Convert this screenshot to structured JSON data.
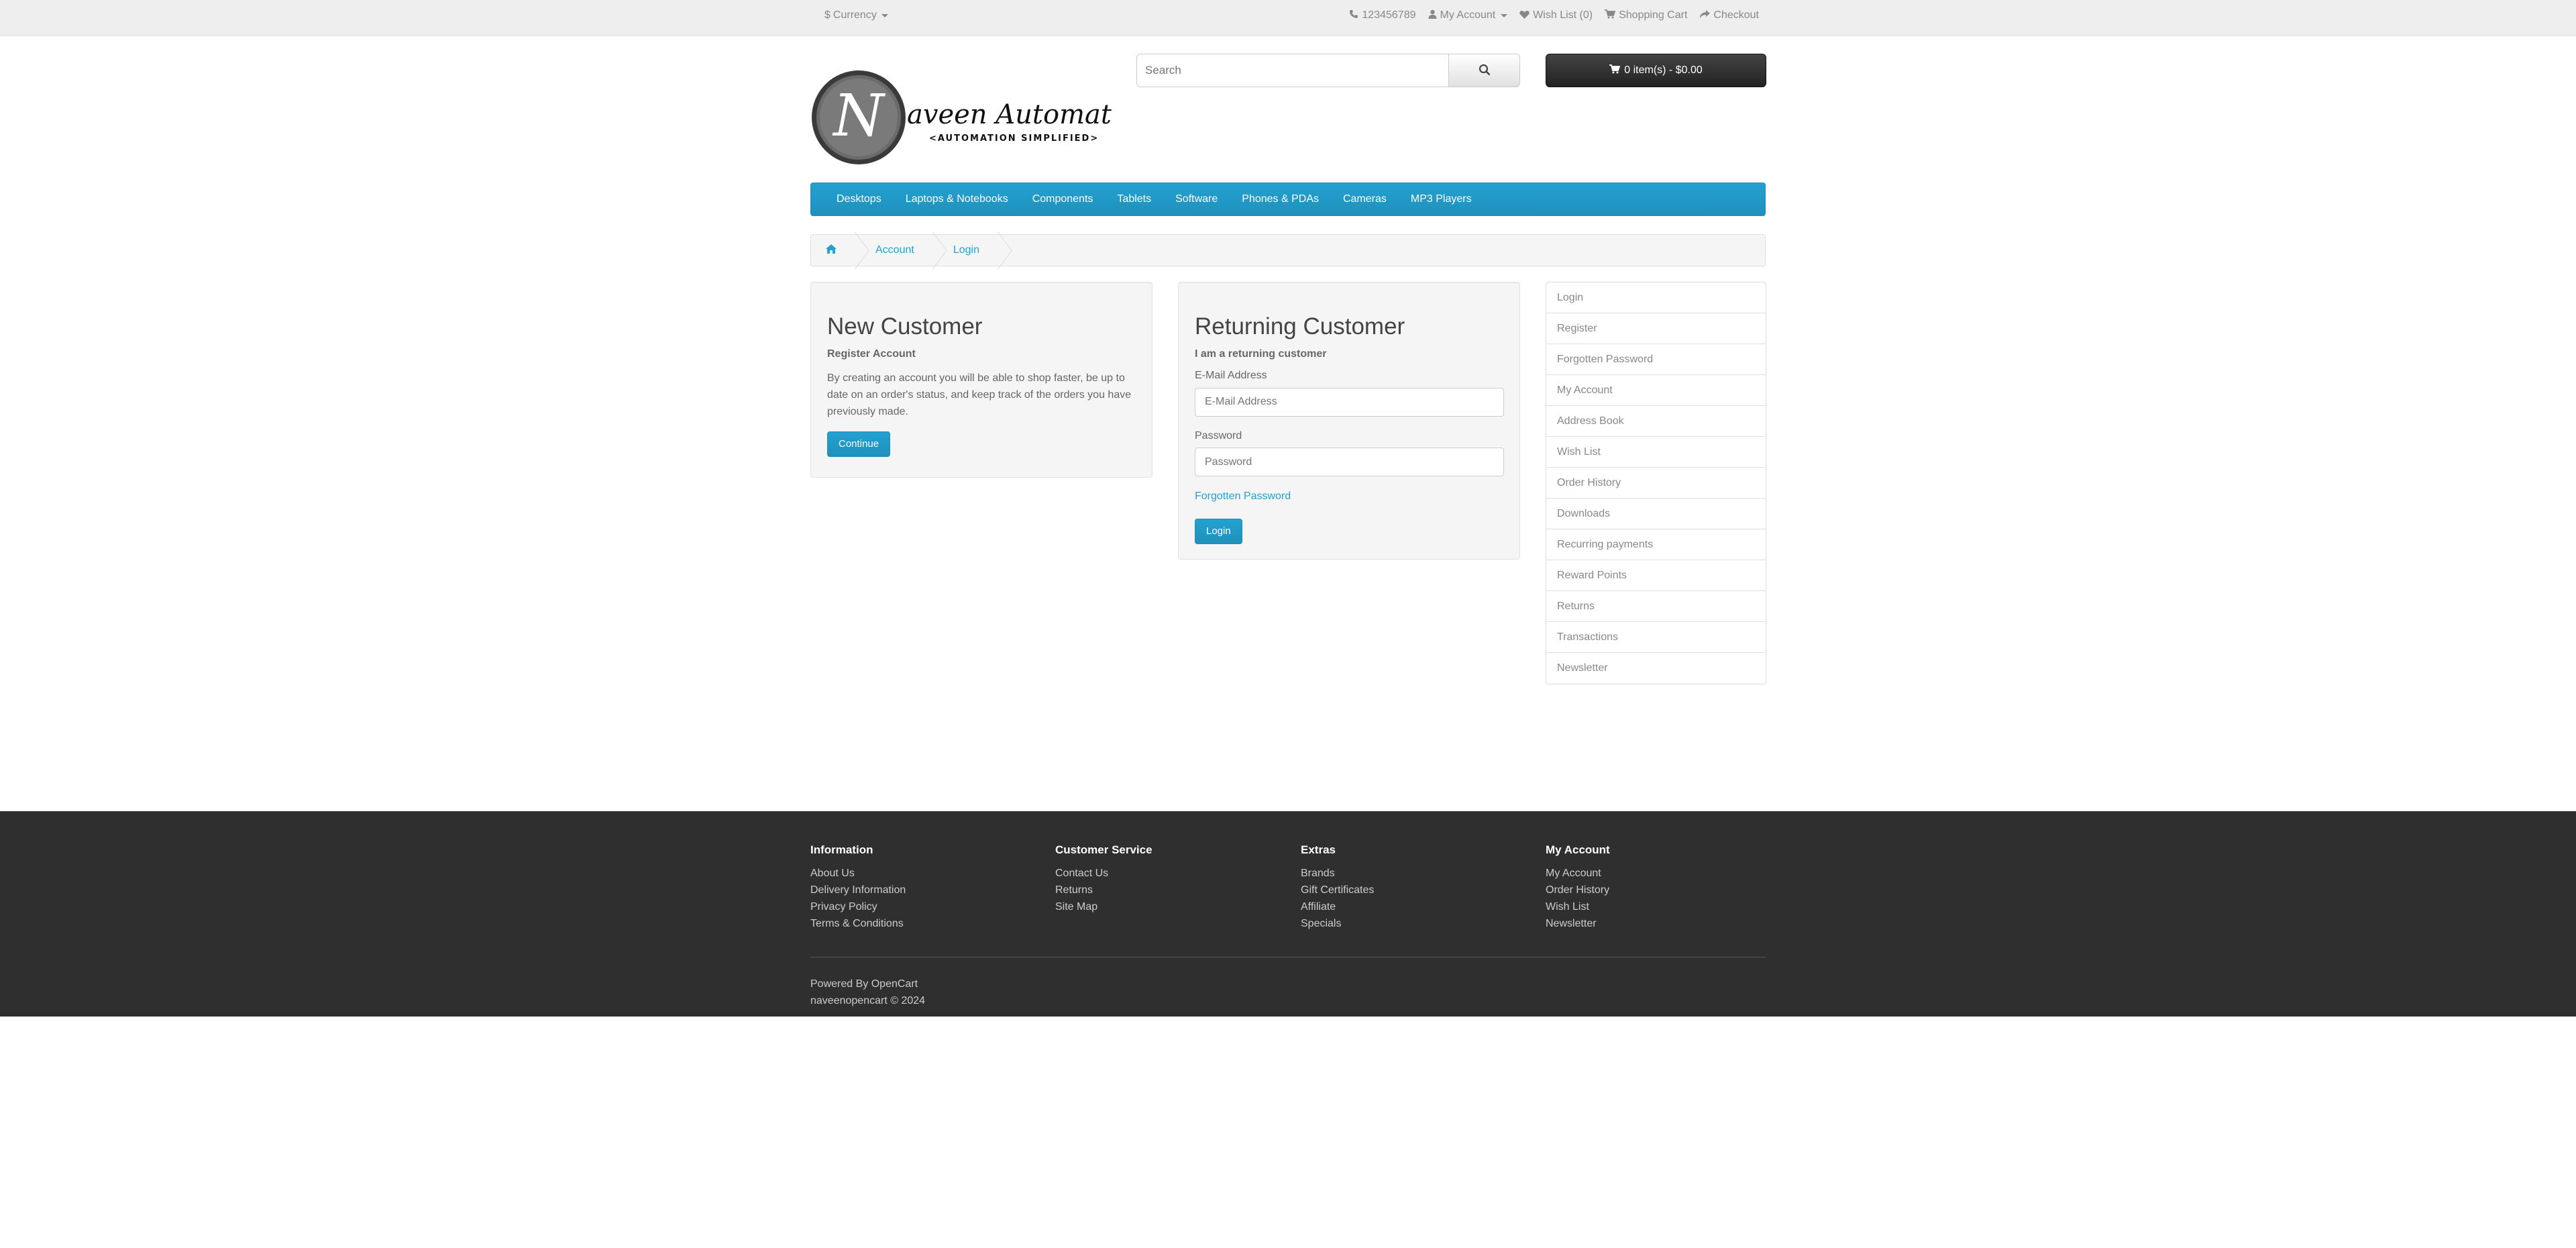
{
  "topbar": {
    "currency_label": "Currency",
    "phone": "123456789",
    "my_account": "My Account",
    "wish_list": "Wish List (0)",
    "shopping_cart": "Shopping Cart",
    "checkout": "Checkout"
  },
  "header": {
    "logo_main": "aveen Automation Labs",
    "logo_letter": "N",
    "logo_tagline": "<AUTOMATION SIMPLIFIED>",
    "search_placeholder": "Search",
    "cart_label": "0 item(s) - $0.00"
  },
  "menu": {
    "items": [
      "Desktops",
      "Laptops & Notebooks",
      "Components",
      "Tablets",
      "Software",
      "Phones & PDAs",
      "Cameras",
      "MP3 Players"
    ]
  },
  "breadcrumb": {
    "items": [
      "Account",
      "Login"
    ]
  },
  "new_customer": {
    "title": "New Customer",
    "subtitle": "Register Account",
    "body": "By creating an account you will be able to shop faster, be up to date on an order's status, and keep track of the orders you have previously made.",
    "button": "Continue"
  },
  "returning_customer": {
    "title": "Returning Customer",
    "subtitle": "I am a returning customer",
    "email_label": "E-Mail Address",
    "email_placeholder": "E-Mail Address",
    "password_label": "Password",
    "password_placeholder": "Password",
    "forgotten_link": "Forgotten Password",
    "button": "Login"
  },
  "sidebar": {
    "items": [
      "Login",
      "Register",
      "Forgotten Password",
      "My Account",
      "Address Book",
      "Wish List",
      "Order History",
      "Downloads",
      "Recurring payments",
      "Reward Points",
      "Returns",
      "Transactions",
      "Newsletter"
    ]
  },
  "footer": {
    "columns": [
      {
        "title": "Information",
        "links": [
          "About Us",
          "Delivery Information",
          "Privacy Policy",
          "Terms & Conditions"
        ]
      },
      {
        "title": "Customer Service",
        "links": [
          "Contact Us",
          "Returns",
          "Site Map"
        ]
      },
      {
        "title": "Extras",
        "links": [
          "Brands",
          "Gift Certificates",
          "Affiliate",
          "Specials"
        ]
      },
      {
        "title": "My Account",
        "links": [
          "My Account",
          "Order History",
          "Wish List",
          "Newsletter"
        ]
      }
    ],
    "powered_by": "Powered By",
    "powered_link": "OpenCart",
    "copyright": "naveenopencart © 2024"
  },
  "colors": {
    "accent": "#23a1d1",
    "footer_bg": "#2f2f2f",
    "cart_bg": "#333333"
  }
}
